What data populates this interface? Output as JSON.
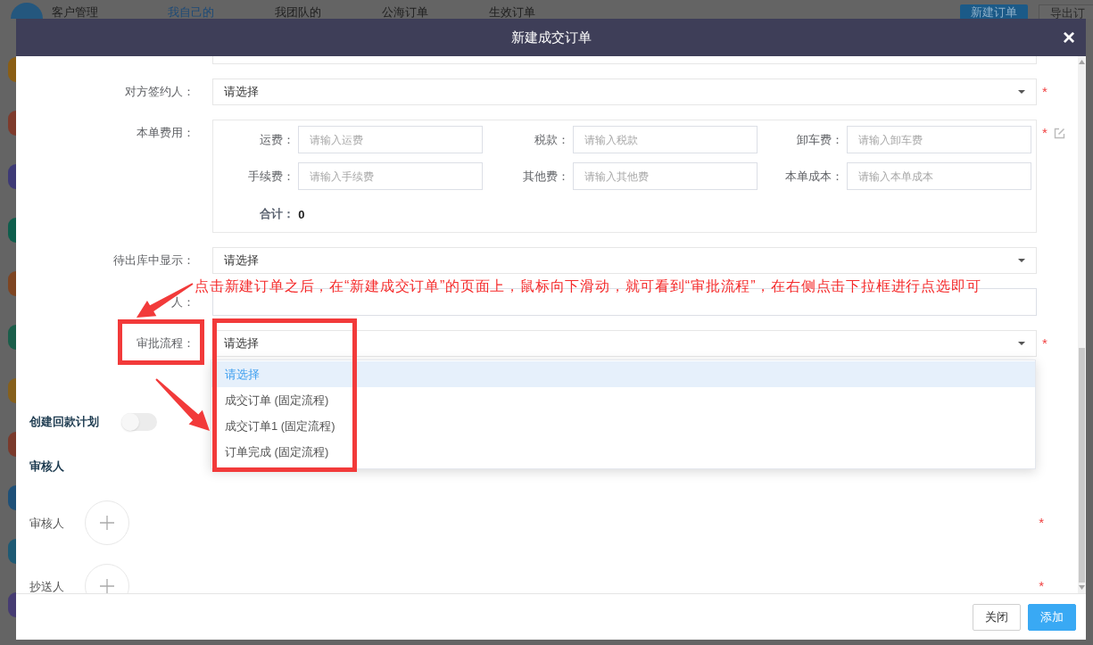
{
  "background": {
    "app_title": "客户管理",
    "tabs": [
      {
        "label": "我自己的",
        "selected": true
      },
      {
        "label": "我团队的",
        "selected": false
      },
      {
        "label": "公海订单",
        "selected": false
      },
      {
        "label": "生效订单",
        "selected": false
      }
    ],
    "buttons": [
      {
        "label": "新建订单",
        "kind": "primary"
      },
      {
        "label": "导出订",
        "kind": "default"
      }
    ],
    "avatars": [
      {
        "color": "#8a5e14"
      },
      {
        "color": "#7e3b2c"
      },
      {
        "color": "#3e3a76"
      },
      {
        "color": "#0e5e4c"
      },
      {
        "color": "#7e4522"
      },
      {
        "color": "#1a5e4a"
      },
      {
        "color": "#86601c"
      },
      {
        "color": "#7a3a2c"
      },
      {
        "color": "#1e5078"
      },
      {
        "color": "#1e5a74"
      },
      {
        "color": "#463c72"
      }
    ]
  },
  "dialog": {
    "title": "新建成交订单",
    "close": "×",
    "fields": [
      {
        "kind": "input",
        "cut_off": true
      },
      {
        "kind": "select",
        "label": "对方签约人：",
        "value": "请选择",
        "mark": "*"
      },
      {
        "kind": "fees",
        "label": "本单费用：",
        "mark": "*",
        "editable": true,
        "items": [
          {
            "label": "运费：",
            "placeholder": "请输入运费"
          },
          {
            "label": "税款：",
            "placeholder": "请输入税款"
          },
          {
            "label": "卸车费：",
            "placeholder": "请输入卸车费"
          },
          {
            "label": "手续费：",
            "placeholder": "请输入手续费"
          },
          {
            "label": "其他费：",
            "placeholder": "请输入其他费"
          },
          {
            "label": "本单成本：",
            "placeholder": "请输入本单成本"
          }
        ],
        "total_label": "合计：",
        "total": "0"
      },
      {
        "kind": "select",
        "label": "待出库中显示：",
        "value": "请选择"
      },
      {
        "kind": "input",
        "label": "人："
      },
      {
        "kind": "select",
        "label": "审批流程：",
        "value": "请选择",
        "mark": "*",
        "expanded": true,
        "options": [
          {
            "label": "请选择",
            "selected": true
          },
          {
            "label": "成交订单 (固定流程)",
            "selected": false
          },
          {
            "label": "成交订单1 (固定流程)",
            "selected": false
          },
          {
            "label": "订单完成 (固定流程)",
            "selected": false
          }
        ]
      }
    ],
    "payment_plan": {
      "label": "创建回款计划",
      "on": false
    },
    "reviewers": {
      "heading": "审核人",
      "rows": [
        {
          "label": "审核人",
          "mark": "*"
        },
        {
          "label": "抄送人",
          "mark": "*"
        }
      ]
    },
    "buttons": [
      {
        "label": "关闭",
        "kind": "default"
      },
      {
        "label": "添加",
        "kind": "primary"
      }
    ]
  },
  "annotation": {
    "text": "点击新建订单之后，在“新建成交订单”的页面上，鼠标向下滑动，就可看到“审批流程”，在右侧点击下拉框进行点选即可"
  }
}
